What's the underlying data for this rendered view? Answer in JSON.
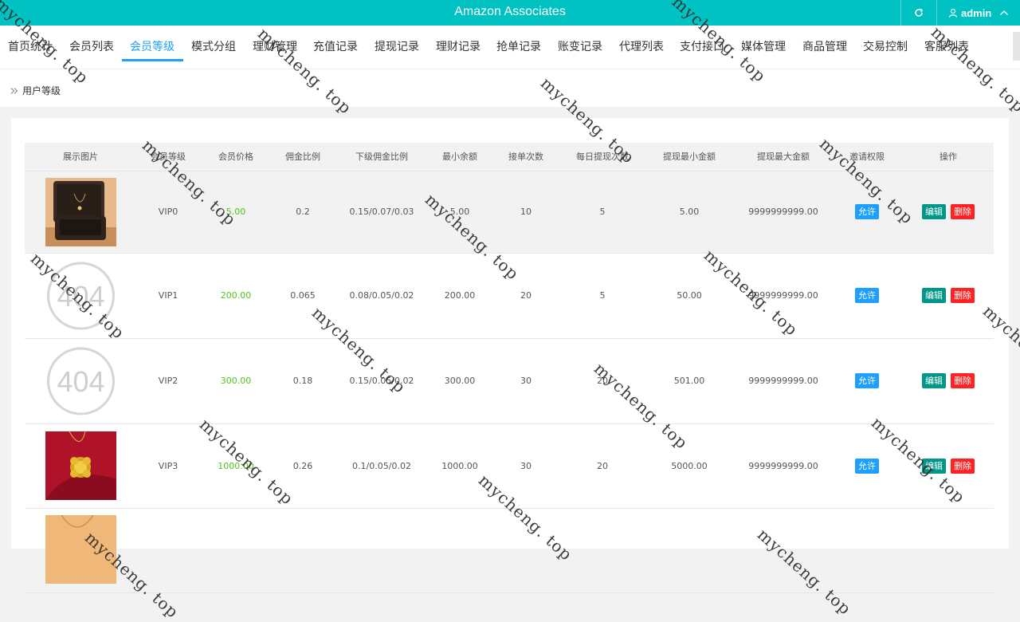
{
  "app": {
    "title": "Amazon Associates",
    "user": "admin"
  },
  "nav": {
    "tabs": [
      {
        "label": "首页统计"
      },
      {
        "label": "会员列表"
      },
      {
        "label": "会员等级"
      },
      {
        "label": "模式分组"
      },
      {
        "label": "理财管理"
      },
      {
        "label": "充值记录"
      },
      {
        "label": "提现记录"
      },
      {
        "label": "理财记录"
      },
      {
        "label": "抢单记录"
      },
      {
        "label": "账变记录"
      },
      {
        "label": "代理列表"
      },
      {
        "label": "支付接口"
      },
      {
        "label": "媒体管理"
      },
      {
        "label": "商品管理"
      },
      {
        "label": "交易控制"
      },
      {
        "label": "客服列表"
      }
    ],
    "active": "会员等级"
  },
  "breadcrumb": "用户等级",
  "table": {
    "headers": [
      "展示图片",
      "会员等级",
      "会员价格",
      "佣金比例",
      "下级佣金比例",
      "最小余额",
      "接单次数",
      "每日提现次数",
      "提现最小金额",
      "提现最大金额",
      "邀请权限",
      "操作"
    ],
    "rows": [
      {
        "image": "jewelry-box",
        "level": "VIP0",
        "price": "5.00",
        "commission": "0.2",
        "sub_commission": "0.15/0.07/0.03",
        "min_balance": "5.00",
        "orders": "10",
        "daily_withdraw": "5",
        "withdraw_min": "5.00",
        "withdraw_max": "9999999999.00",
        "invite": "允许",
        "edit": "编辑",
        "delete": "删除"
      },
      {
        "image": "404",
        "image_text": "404",
        "level": "VIP1",
        "price": "200.00",
        "commission": "0.065",
        "sub_commission": "0.08/0.05/0.02",
        "min_balance": "200.00",
        "orders": "20",
        "daily_withdraw": "5",
        "withdraw_min": "50.00",
        "withdraw_max": "9999999999.00",
        "invite": "允许",
        "edit": "编辑",
        "delete": "删除"
      },
      {
        "image": "404",
        "image_text": "404",
        "level": "VIP2",
        "price": "300.00",
        "commission": "0.18",
        "sub_commission": "0.15/0.05/0.02",
        "min_balance": "300.00",
        "orders": "30",
        "daily_withdraw": "20",
        "withdraw_min": "501.00",
        "withdraw_max": "9999999999.00",
        "invite": "允许",
        "edit": "编辑",
        "delete": "删除"
      },
      {
        "image": "gold-pendant",
        "level": "VIP3",
        "price": "1000.00",
        "commission": "0.26",
        "sub_commission": "0.1/0.05/0.02",
        "min_balance": "1000.00",
        "orders": "30",
        "daily_withdraw": "20",
        "withdraw_min": "5000.00",
        "withdraw_max": "9999999999.00",
        "invite": "允许",
        "edit": "编辑",
        "delete": "删除"
      },
      {
        "image": "gold-chain"
      }
    ]
  },
  "watermark": "mycheng. top",
  "colors": {
    "topbar": "#00c2c2",
    "accent": "#1e9fff",
    "price": "#52c41a",
    "edit": "#009688",
    "delete": "#ff2222"
  }
}
